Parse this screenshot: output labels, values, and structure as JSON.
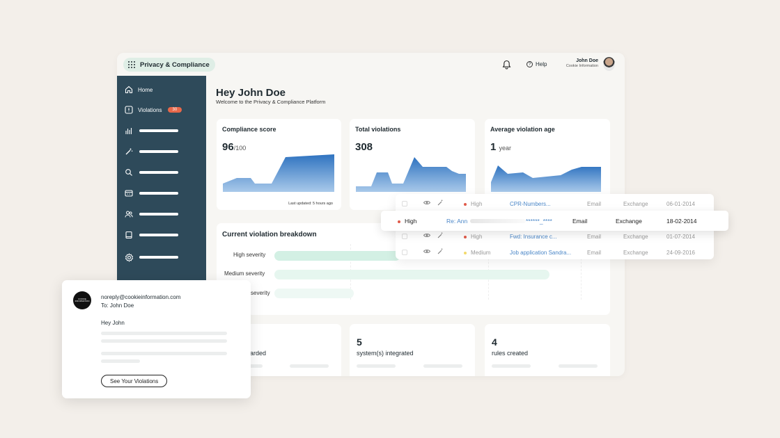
{
  "app": {
    "title": "Privacy & Compliance"
  },
  "header": {
    "help_label": "Help",
    "user_name": "John Doe",
    "user_company": "Cookie Information"
  },
  "sidebar": {
    "home_label": "Home",
    "violations_label": "Violations",
    "violations_count": "30"
  },
  "main": {
    "greeting": "Hey John Doe",
    "subtitle": "Welcome to the Privacy & Compliance Platform"
  },
  "cards": {
    "compliance": {
      "title": "Compliance score",
      "value": "96",
      "unit": "/100",
      "footer": "Last updated: 5 hours ago"
    },
    "total": {
      "title": "Total violations",
      "value": "308"
    },
    "age": {
      "title": "Average violation age",
      "value": "1",
      "unit": "year"
    }
  },
  "breakdown": {
    "title": "Current violation breakdown",
    "categories": [
      "High severity",
      "Medium severity",
      "severity"
    ],
    "bar_fractions": [
      0.38,
      0.83,
      0.24
    ]
  },
  "kpis": [
    {
      "value": "",
      "label": "e(s) onboarded"
    },
    {
      "value": "5",
      "label": "system(s) integrated"
    },
    {
      "value": "4",
      "label": "rules created"
    }
  ],
  "table": {
    "rows": [
      {
        "severity": "High",
        "subject": "CPR-Numbers...",
        "type": "Email",
        "source": "Exchange",
        "date": "06-01-2014"
      },
      {
        "severity": "High",
        "subject": "Fwd: Insurance c...",
        "type": "Email",
        "source": "Exchange",
        "date": "01-07-2014"
      },
      {
        "severity": "Medium",
        "subject": "Job application Sandra...",
        "type": "Email",
        "source": "Exchange",
        "date": "24-09-2016"
      }
    ],
    "highlight": {
      "severity": "High",
      "subject": "Re: Ann",
      "masked": "******_****",
      "type": "Email",
      "source": "Exchange",
      "date": "18-02-2014"
    }
  },
  "email": {
    "from": "noreply@cookieinformation.com",
    "to": "To: John Doe",
    "greeting": "Hey John",
    "button": "See Your Violations",
    "logo_text": "COOKIE INFORMATION"
  },
  "colors": {
    "sidebar": "#2e4a5a",
    "accent_blue": "#3a7cc4",
    "badge": "#e8684a",
    "mint": "#d8f2e6"
  }
}
